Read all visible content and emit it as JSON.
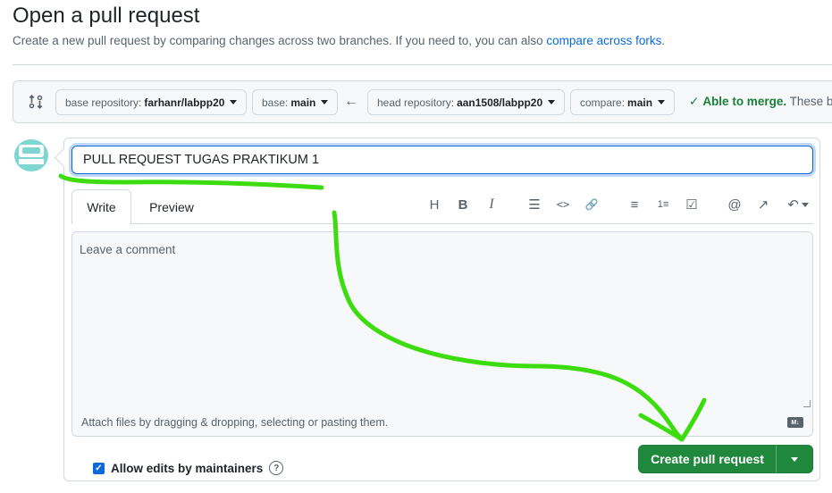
{
  "header": {
    "title": "Open a pull request",
    "subtitle": "Create a new pull request by comparing changes across two branches. If you need to, you can also ",
    "subtitle_link": "compare across forks",
    "subtitle_end": "."
  },
  "range": {
    "base_repository_label": "base repository:",
    "base_repository_value": "farhanr/labpp20",
    "base_label": "base:",
    "base_value": "main",
    "head_repository_label": "head repository:",
    "head_repository_value": "aan1508/labpp20",
    "compare_label": "compare:",
    "compare_value": "main",
    "merge_status": "Able to merge.",
    "merge_status_extra": " These b"
  },
  "form": {
    "title_value": "PULL REQUEST TUGAS PRAKTIKUM 1",
    "tabs": {
      "write": "Write",
      "preview": "Preview"
    },
    "comment_placeholder": "Leave a comment",
    "attach_hint": "Attach files by dragging & dropping, selecting or pasting them.",
    "markdown_badge": "M↓",
    "allow_edits_label": "Allow edits by maintainers",
    "allow_edits_checked": true,
    "create_button": "Create pull request"
  },
  "toolbar": {
    "heading": "H",
    "bold": "B",
    "italic": "I",
    "quote": "☰",
    "code": "<>",
    "link": "🔗",
    "bulleted_list": "≡",
    "numbered_list": "1≡",
    "task_list": "☑",
    "mention": "@",
    "reference": "↗",
    "undo": "↶"
  },
  "colors": {
    "accent": "#0969da",
    "primary_button": "#1f883d",
    "annotation": "#3ddc0f"
  }
}
